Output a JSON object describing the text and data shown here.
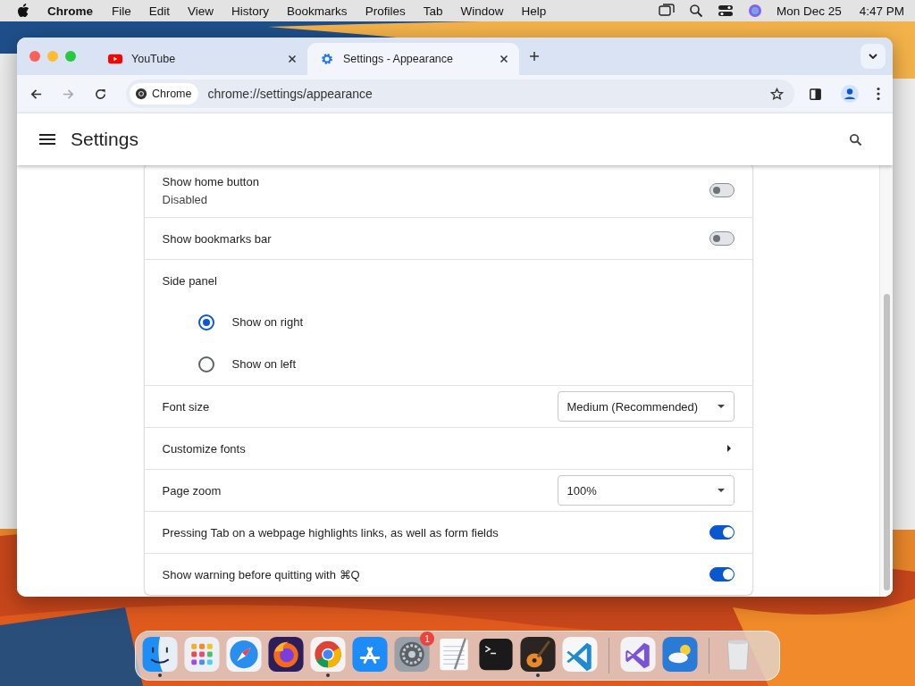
{
  "menu_bar": {
    "app_name": "Chrome",
    "menus": [
      "File",
      "Edit",
      "View",
      "History",
      "Bookmarks",
      "Profiles",
      "Tab",
      "Window",
      "Help"
    ],
    "date": "Mon Dec 25",
    "time": "4:47 PM"
  },
  "tabs": [
    {
      "kind": "youtube",
      "title": "YouTube",
      "selected": false
    },
    {
      "kind": "settings",
      "title": "Settings - Appearance",
      "selected": true
    }
  ],
  "toolbar": {
    "chip": "Chrome",
    "url": "chrome://settings/appearance"
  },
  "header": {
    "title": "Settings"
  },
  "rows": [
    {
      "kind": "toggle",
      "label": "Show home button",
      "sublabel": "Disabled",
      "on": false
    },
    {
      "kind": "toggle",
      "label": "Show bookmarks bar",
      "on": false
    },
    {
      "kind": "heading",
      "label": "Side panel"
    },
    {
      "kind": "radio",
      "label": "Show on right",
      "selected": true
    },
    {
      "kind": "radio",
      "label": "Show on left",
      "selected": false
    },
    {
      "kind": "dropdown",
      "label": "Font size",
      "value": "Medium (Recommended)"
    },
    {
      "kind": "link",
      "label": "Customize fonts"
    },
    {
      "kind": "dropdown",
      "label": "Page zoom",
      "value": "100%"
    },
    {
      "kind": "toggle",
      "label": "Pressing Tab on a webpage highlights links, as well as form fields",
      "on": true
    },
    {
      "kind": "toggle",
      "label": "Show warning before quitting with ⌘Q",
      "on": true
    }
  ],
  "dock": [
    {
      "kind": "finder",
      "running": true
    },
    {
      "kind": "launchpad",
      "running": false
    },
    {
      "kind": "safari",
      "running": false
    },
    {
      "kind": "firefox",
      "running": false
    },
    {
      "kind": "chrome",
      "running": true
    },
    {
      "kind": "appstore",
      "running": false
    },
    {
      "kind": "settings",
      "running": false,
      "badge": "1"
    },
    {
      "kind": "textedit",
      "running": false
    },
    {
      "kind": "terminal",
      "running": false
    },
    {
      "kind": "garageband",
      "running": true
    },
    {
      "kind": "vscode",
      "running": false
    },
    {
      "kind": "separator"
    },
    {
      "kind": "visualstudio",
      "running": false
    },
    {
      "kind": "weather",
      "running": false
    },
    {
      "kind": "separator"
    },
    {
      "kind": "trash",
      "running": false
    }
  ]
}
